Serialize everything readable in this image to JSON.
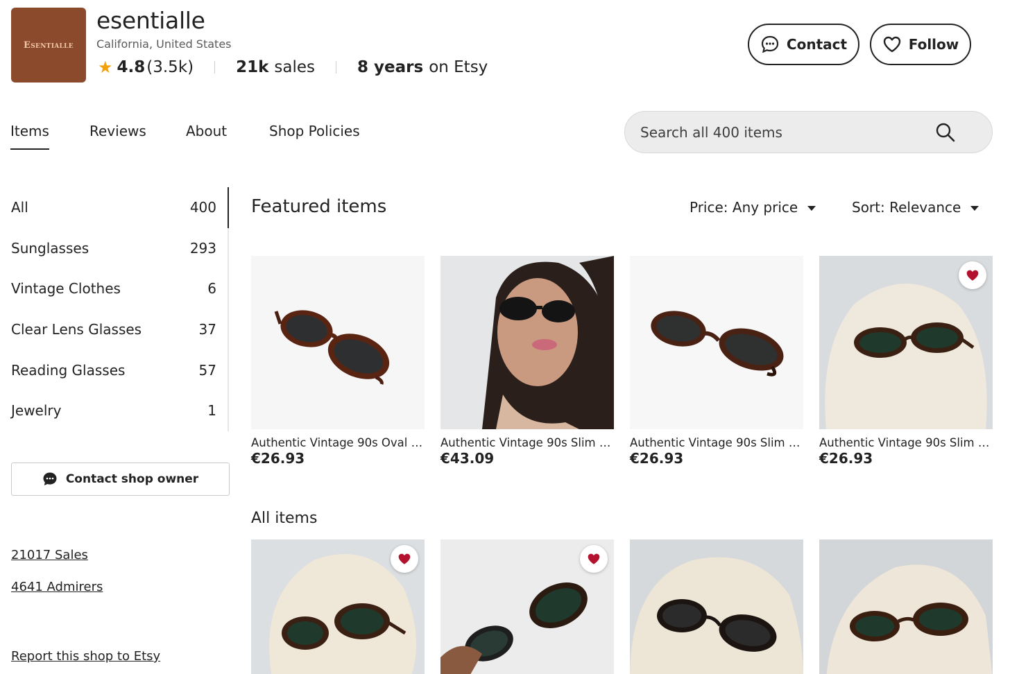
{
  "shop": {
    "logo_text": "Esentialle",
    "name": "esentialle",
    "location": "California, United States",
    "rating": "4.8",
    "review_count": "(3.5k)",
    "sales_num": "21k",
    "sales_label": "sales",
    "years_num": "8 years",
    "years_label": "on Etsy"
  },
  "actions": {
    "contact": "Contact",
    "follow": "Follow"
  },
  "tabs": [
    {
      "label": "Items"
    },
    {
      "label": "Reviews"
    },
    {
      "label": "About"
    },
    {
      "label": "Shop Policies"
    }
  ],
  "search": {
    "placeholder": "Search all 400 items"
  },
  "categories": [
    {
      "name": "All",
      "count": "400"
    },
    {
      "name": "Sunglasses",
      "count": "293"
    },
    {
      "name": "Vintage Clothes",
      "count": "6"
    },
    {
      "name": "Clear Lens Glasses",
      "count": "37"
    },
    {
      "name": "Reading Glasses",
      "count": "57"
    },
    {
      "name": "Jewelry",
      "count": "1"
    }
  ],
  "sidebar": {
    "contact_owner": "Contact shop owner",
    "sales_link": "21017 Sales",
    "admirers_link": "4641 Admirers",
    "report_link": "Report this shop to Etsy"
  },
  "featured": {
    "title": "Featured items",
    "price_filter": "Price: Any price",
    "sort": "Sort: Relevance",
    "items": [
      {
        "title": "Authentic Vintage 90s Oval T...",
        "price": "€26.93"
      },
      {
        "title": "Authentic Vintage 90s Slim B...",
        "price": "€43.09"
      },
      {
        "title": "Authentic Vintage 90s Slim T...",
        "price": "€26.93"
      },
      {
        "title": "Authentic Vintage 90s Slim T...",
        "price": "€26.93"
      }
    ]
  },
  "all_items": {
    "title": "All items"
  },
  "colors": {
    "accent": "#222222",
    "favorite": "#b3122e",
    "logo_bg": "#8b4a2c",
    "star": "#f1a10b"
  }
}
